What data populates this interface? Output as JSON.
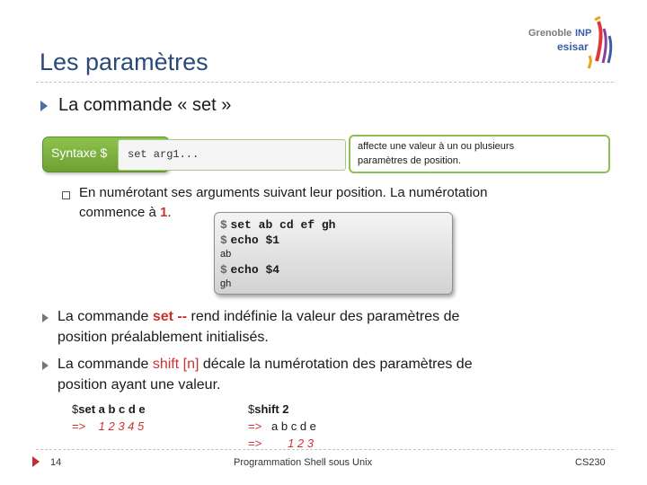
{
  "title": "Les paramètres",
  "bullet1": "La commande « set »",
  "syntax": {
    "label": "Syntaxe $",
    "code": "set arg1...",
    "desc_line1": "affecte une valeur à un ou plusieurs",
    "desc_line2": "paramètres de position."
  },
  "sub_bullet": {
    "line1": "En numérotant ses arguments suivant leur position. La numérotation",
    "line2_prefix": "commence à ",
    "line2_highlight": "1",
    "line2_suffix": "."
  },
  "terminal": {
    "prompt": "$",
    "cmd1": "set ab cd ef gh",
    "cmd2": "echo $1",
    "out1": "ab",
    "cmd3": "echo $4",
    "out2": "gh"
  },
  "bullet2": {
    "prefix": "La commande ",
    "highlight": "set --",
    "suffix": " rend indéfinie la valeur des paramètres de",
    "line2": "position préalablement initialisés."
  },
  "bullet3": {
    "prefix": "La commande ",
    "highlight": "shift [n]",
    "suffix": " décale la numérotation des paramètres de",
    "line2": "position ayant une valeur."
  },
  "example_left": {
    "prompt": "$",
    "cmd": "set a b c d e",
    "arrow": "=>",
    "result": "1 2 3 4 5"
  },
  "example_right": {
    "prompt": "$",
    "cmd": "shift 2",
    "arrow1": "=>",
    "result1": "a b c d e",
    "arrow2": "=>",
    "result2": "1 2 3"
  },
  "footer": {
    "page": "14",
    "center": "Programmation Shell sous Unix",
    "right": "CS230"
  },
  "logo": {
    "line1": "Grenoble",
    "line1b": "INP",
    "line2": "esisar"
  },
  "colors": {
    "title": "#2b4a78",
    "accent_red": "#d0312d",
    "syntax_green": "#7ab03e"
  }
}
